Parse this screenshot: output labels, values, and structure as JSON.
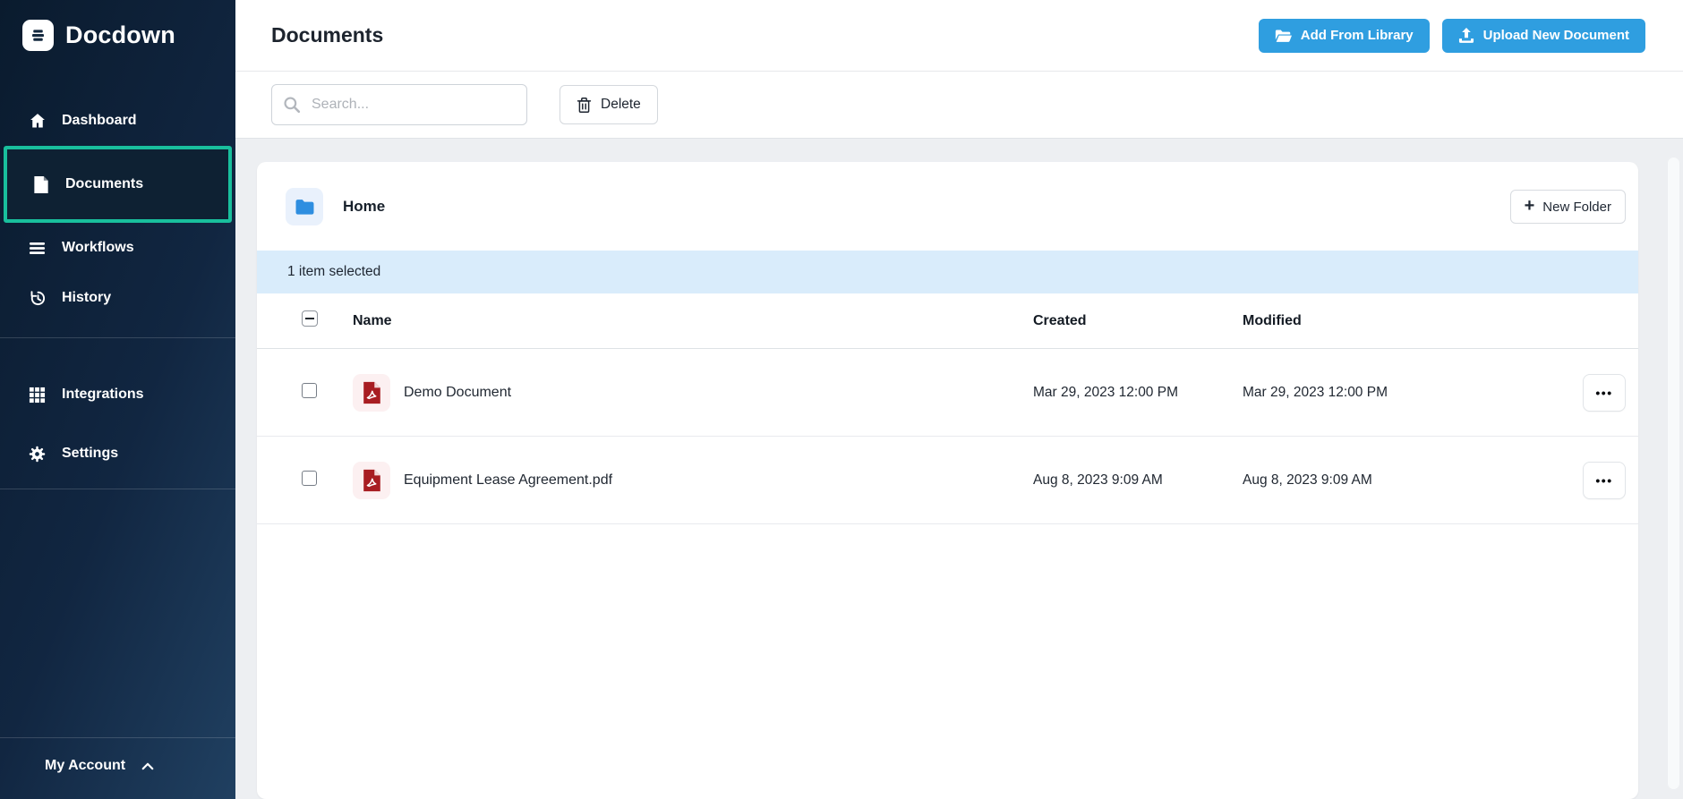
{
  "app": {
    "name": "Docdown"
  },
  "sidebar": {
    "items": [
      {
        "label": "Dashboard",
        "icon": "home-icon",
        "active": false
      },
      {
        "label": "Documents",
        "icon": "document-icon",
        "active": true
      },
      {
        "label": "Workflows",
        "icon": "list-icon",
        "active": false
      },
      {
        "label": "History",
        "icon": "history-icon",
        "active": false
      },
      {
        "label": "Integrations",
        "icon": "grid-icon",
        "active": false
      },
      {
        "label": "Settings",
        "icon": "gear-icon",
        "active": false
      }
    ],
    "account_label": "My Account"
  },
  "header": {
    "title": "Documents",
    "add_from_library_label": "Add From Library",
    "upload_label": "Upload New Document"
  },
  "toolbar": {
    "search_placeholder": "Search...",
    "delete_label": "Delete"
  },
  "content": {
    "breadcrumb": "Home",
    "new_folder_label": "New Folder",
    "selection_status": "1 item selected",
    "table": {
      "columns": [
        "Name",
        "Created",
        "Modified"
      ],
      "rows": [
        {
          "name": "Demo Document",
          "type": "pdf",
          "created": "Mar 29, 2023 12:00 PM",
          "modified": "Mar 29, 2023 12:00 PM"
        },
        {
          "name": "Equipment Lease Agreement.pdf",
          "type": "pdf",
          "created": "Aug 8, 2023 9:09 AM",
          "modified": "Aug 8, 2023 9:09 AM"
        }
      ]
    }
  },
  "icons": {
    "plus": "+",
    "ellipsis": "•••"
  },
  "colors": {
    "accent_blue": "#2f9ee0",
    "active_border_teal": "#19bf9d",
    "selection_bar_blue": "#d9ecfb",
    "pdf_red": "#a81d22",
    "folder_blue": "#2e8ee0",
    "sidebar_navy": "#112641"
  }
}
